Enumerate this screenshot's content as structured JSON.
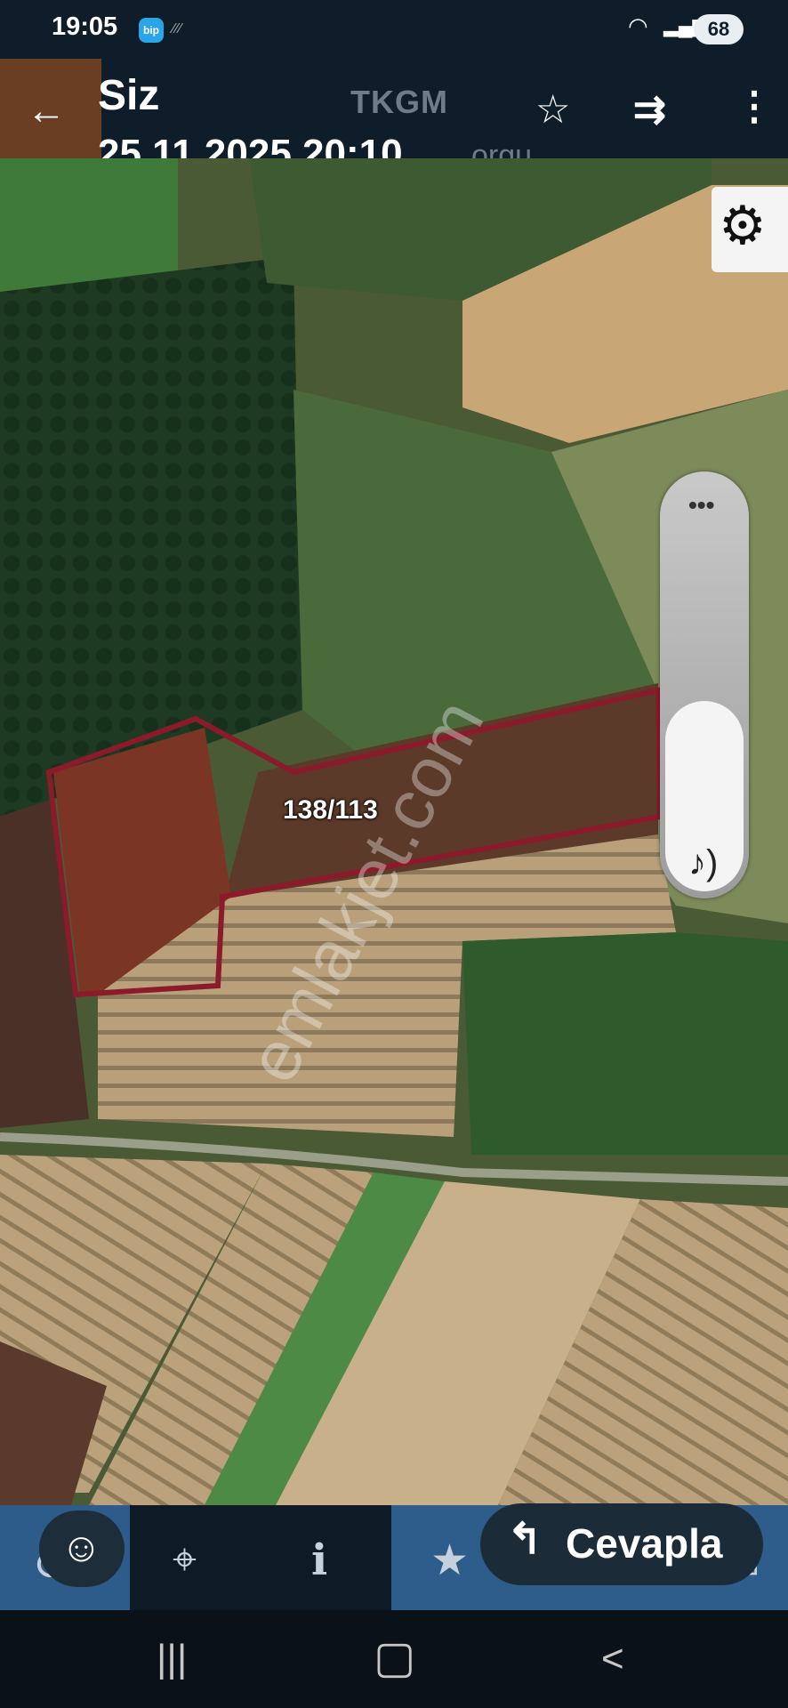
{
  "status_bar": {
    "time": "19:05",
    "app_badge": "bip",
    "battery": "68"
  },
  "header": {
    "title": "Siz",
    "date": "25.11.2025 20:10",
    "background_app_title": "TKGM",
    "background_app_subtitle": "orgu",
    "icons": [
      "back-arrow-icon",
      "star-icon",
      "forward-icon",
      "more-vert-icon"
    ]
  },
  "map": {
    "parcel_label": "138/113",
    "watermark": "emlakjet.com",
    "parcel_outline_color": "#8b1a2a"
  },
  "reply": {
    "label": "Cevapla"
  },
  "colors": {
    "header_bg": "#0f1d2a",
    "toolbar_bg": "#2e5d8c",
    "nav_bg": "#0a1118"
  }
}
